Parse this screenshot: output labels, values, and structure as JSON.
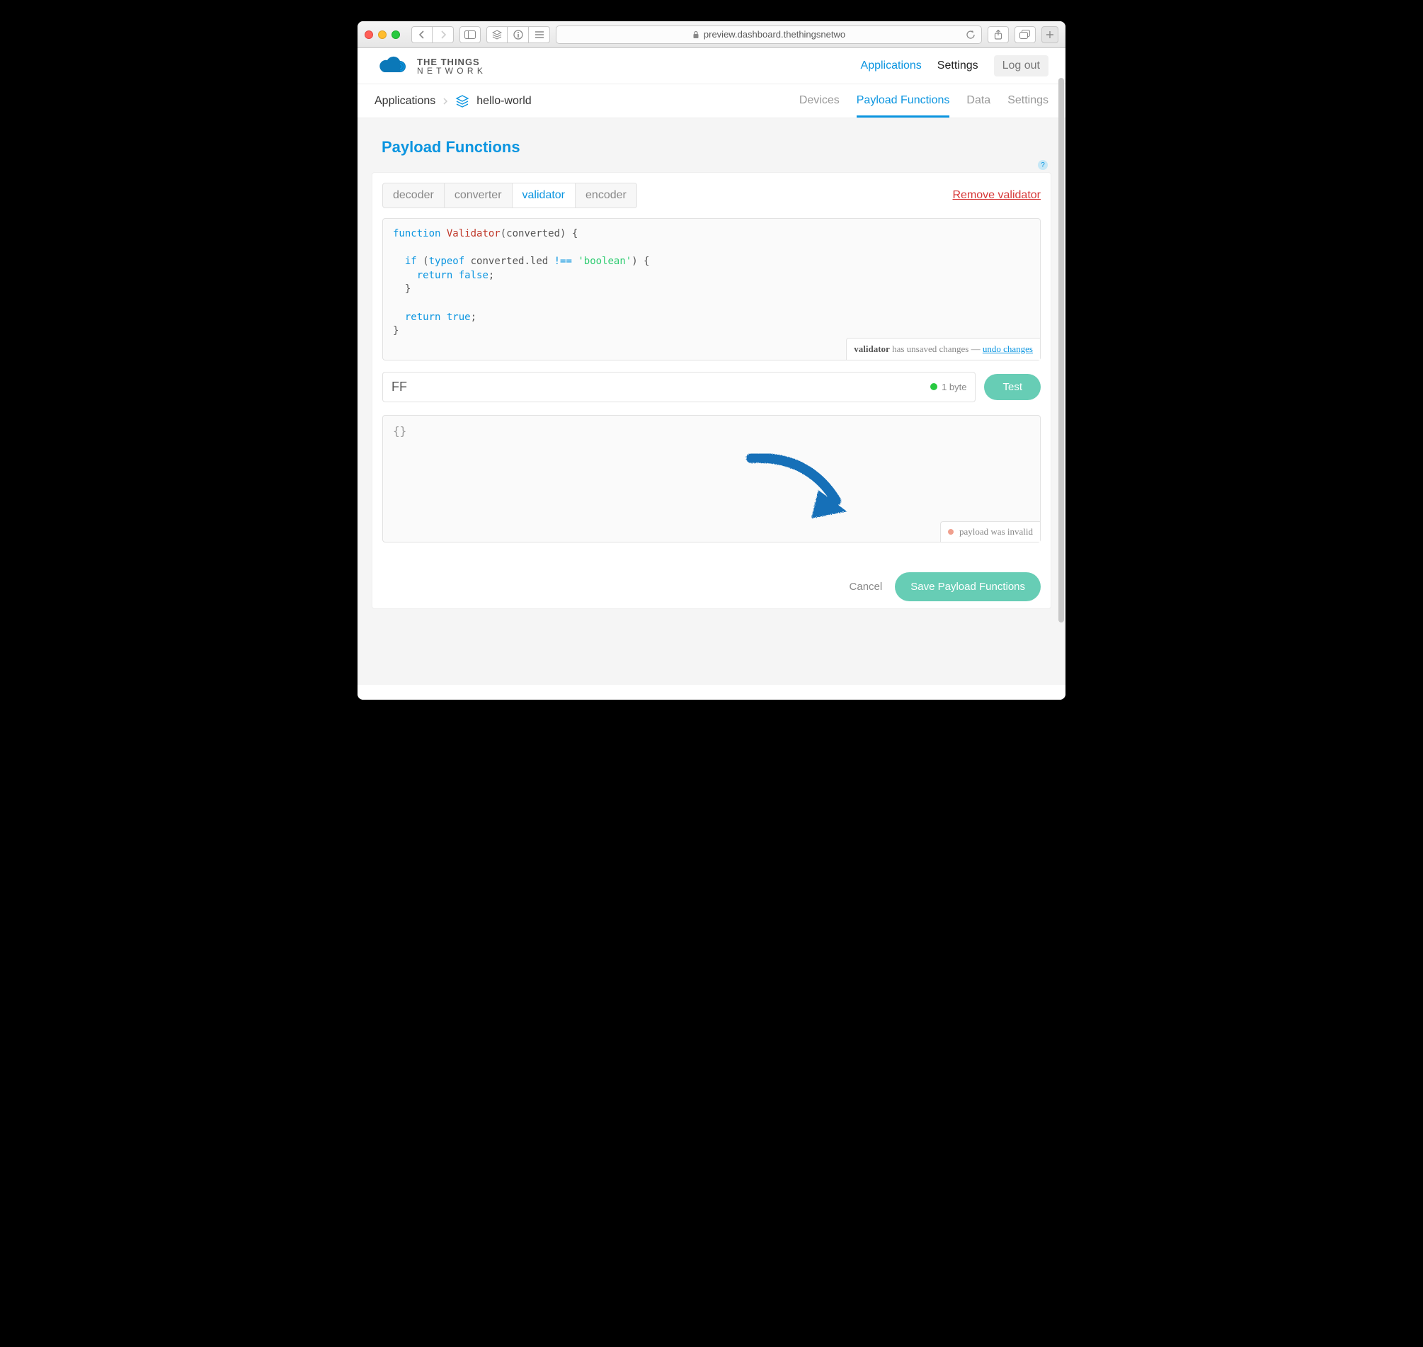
{
  "browser": {
    "url": "preview.dashboard.thethingsnetwo"
  },
  "brand": {
    "line1": "THE THINGS",
    "line2": "N E T W O R K"
  },
  "topnav": {
    "applications": "Applications",
    "settings": "Settings",
    "logout": "Log out"
  },
  "breadcrumb": {
    "root": "Applications",
    "app": "hello-world"
  },
  "app_tabs": [
    "Devices",
    "Payload Functions",
    "Data",
    "Settings"
  ],
  "app_tab_active": 1,
  "page_title": "Payload Functions",
  "fn_tabs": [
    "decoder",
    "converter",
    "validator",
    "encoder"
  ],
  "fn_tab_active": 2,
  "remove_label": "Remove validator",
  "code": {
    "l1a": "function",
    "l1b": "Validator",
    "l1c": "(converted) {",
    "l2a": "if",
    "l2b": "(",
    "l2c": "typeof",
    "l2d": " converted.led ",
    "l2e": "!==",
    "l2f": "'boolean'",
    "l2g": ") {",
    "l3a": "return",
    "l3b": "false",
    "l3c": ";",
    "l4": "}",
    "l5a": "return",
    "l5b": "true",
    "l5c": ";",
    "l6": "}"
  },
  "unsaved": {
    "name": "validator",
    "msg": " has unsaved changes — ",
    "undo": "undo changes"
  },
  "test": {
    "hex": "FF",
    "bytes": "1 byte",
    "btn": "Test"
  },
  "output": {
    "body": "{}",
    "status": "payload was invalid"
  },
  "actions": {
    "cancel": "Cancel",
    "save": "Save Payload Functions"
  }
}
